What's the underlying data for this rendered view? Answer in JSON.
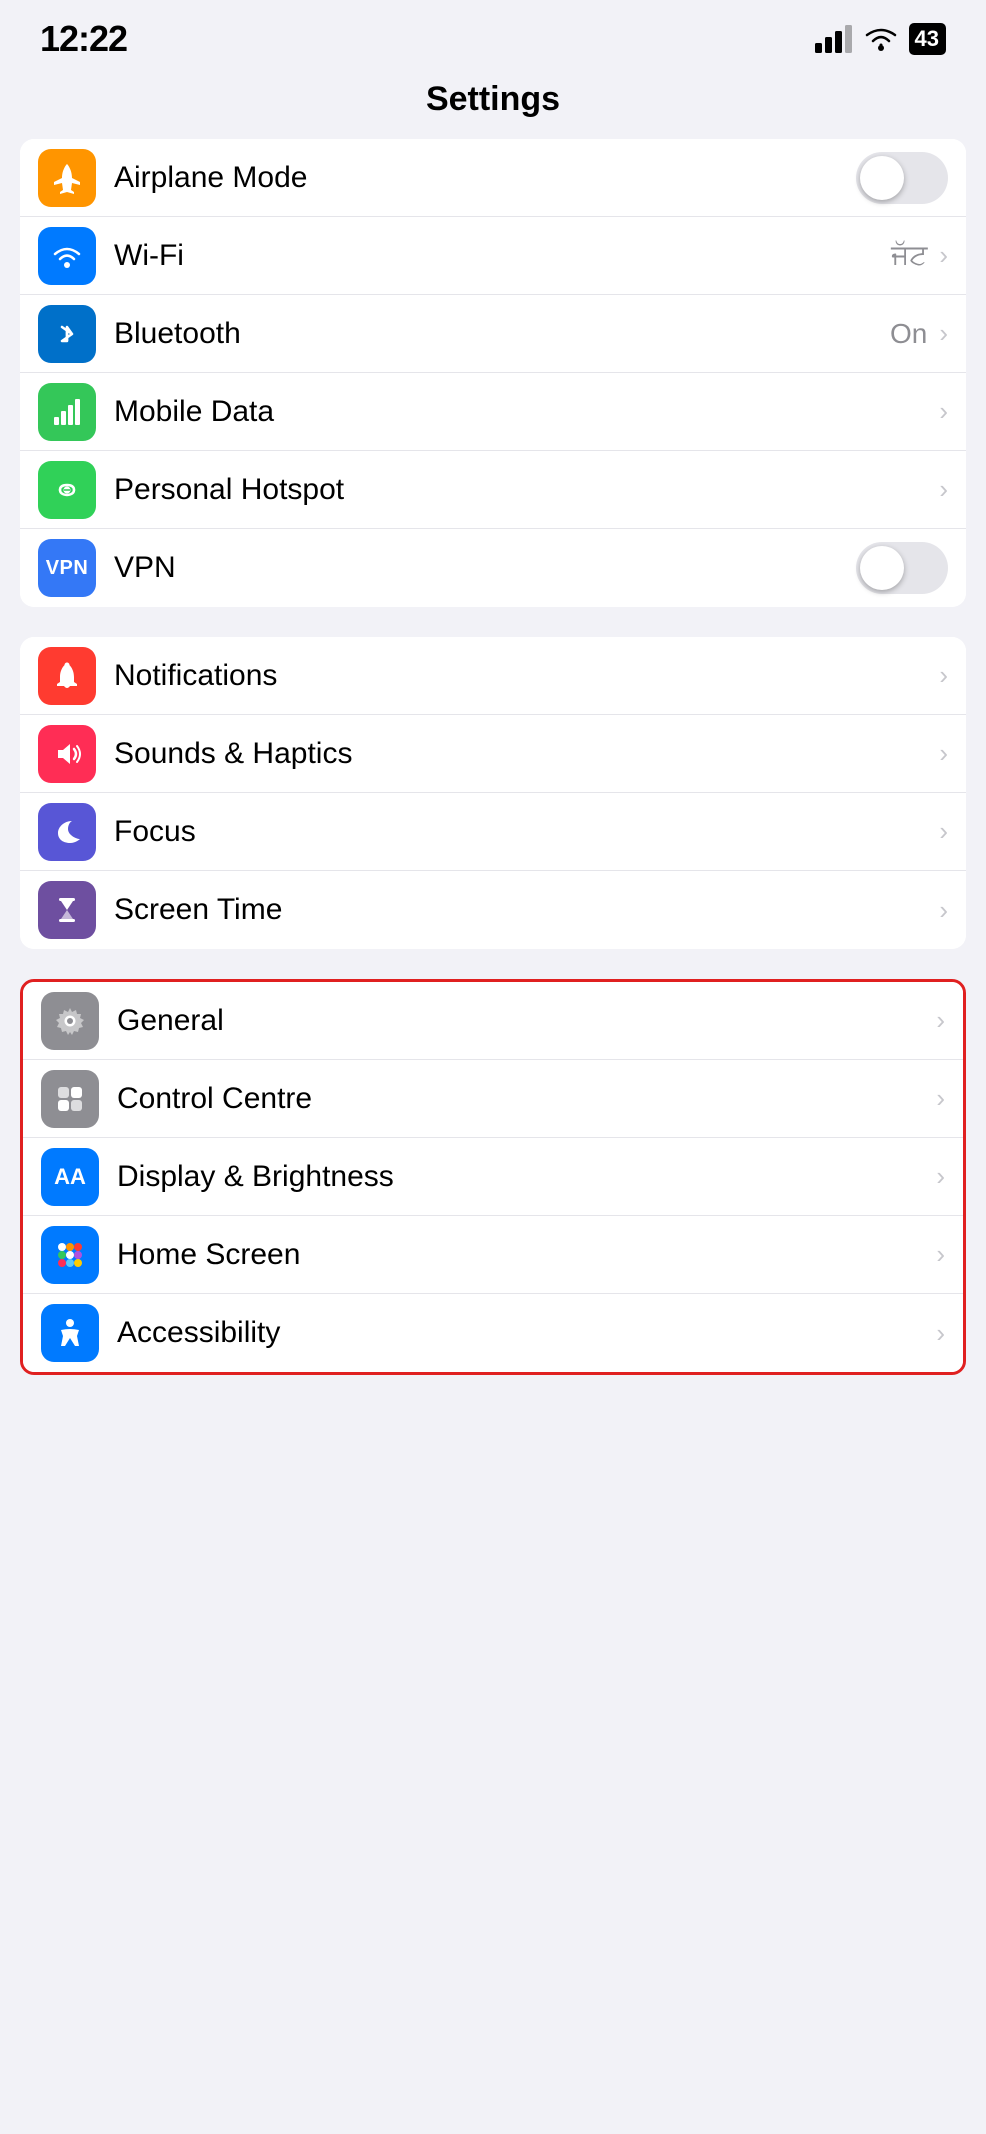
{
  "statusBar": {
    "time": "12:22",
    "battery": "43"
  },
  "pageTitle": "Settings",
  "sections": [
    {
      "id": "connectivity",
      "highlighted": false,
      "rows": [
        {
          "id": "airplane-mode",
          "label": "Airplane Mode",
          "iconBg": "icon-orange",
          "iconType": "airplane",
          "control": "toggle",
          "toggleOn": false
        },
        {
          "id": "wifi",
          "label": "Wi-Fi",
          "iconBg": "icon-blue",
          "iconType": "wifi",
          "control": "value-chevron",
          "value": "ਜੱਟ"
        },
        {
          "id": "bluetooth",
          "label": "Bluetooth",
          "iconBg": "icon-blue-dark",
          "iconType": "bluetooth",
          "control": "value-chevron",
          "value": "On"
        },
        {
          "id": "mobile-data",
          "label": "Mobile Data",
          "iconBg": "icon-green",
          "iconType": "signal",
          "control": "chevron"
        },
        {
          "id": "personal-hotspot",
          "label": "Personal Hotspot",
          "iconBg": "icon-green-alt",
          "iconType": "hotspot",
          "control": "chevron"
        },
        {
          "id": "vpn",
          "label": "VPN",
          "iconBg": "icon-blue-vpn",
          "iconType": "vpn",
          "control": "toggle",
          "toggleOn": false
        }
      ]
    },
    {
      "id": "system",
      "highlighted": false,
      "rows": [
        {
          "id": "notifications",
          "label": "Notifications",
          "iconBg": "icon-red",
          "iconType": "bell",
          "control": "chevron"
        },
        {
          "id": "sounds-haptics",
          "label": "Sounds & Haptics",
          "iconBg": "icon-pink",
          "iconType": "speaker",
          "control": "chevron"
        },
        {
          "id": "focus",
          "label": "Focus",
          "iconBg": "icon-purple",
          "iconType": "moon",
          "control": "chevron"
        },
        {
          "id": "screen-time",
          "label": "Screen Time",
          "iconBg": "icon-purple-dark",
          "iconType": "hourglass",
          "control": "chevron"
        }
      ]
    },
    {
      "id": "device",
      "highlighted": false,
      "rows": [
        {
          "id": "general",
          "label": "General",
          "iconBg": "icon-gray",
          "iconType": "gear",
          "control": "chevron",
          "highlighted": true
        },
        {
          "id": "control-centre",
          "label": "Control Centre",
          "iconBg": "icon-gray",
          "iconType": "toggles",
          "control": "chevron"
        },
        {
          "id": "display-brightness",
          "label": "Display & Brightness",
          "iconBg": "icon-blue",
          "iconType": "aa",
          "control": "chevron"
        },
        {
          "id": "home-screen",
          "label": "Home Screen",
          "iconBg": "icon-blue",
          "iconType": "dots",
          "control": "chevron"
        },
        {
          "id": "accessibility",
          "label": "Accessibility",
          "iconBg": "icon-blue",
          "iconType": "accessibility",
          "control": "chevron"
        }
      ]
    }
  ]
}
